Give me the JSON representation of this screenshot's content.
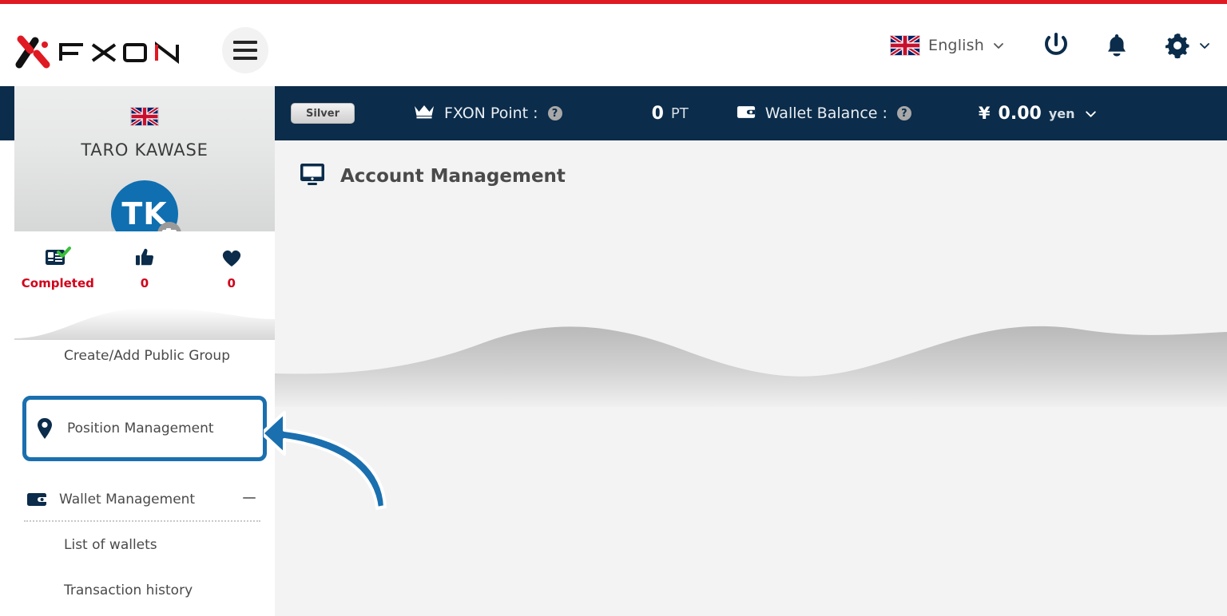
{
  "theme": {
    "accent_red": "#e01a22",
    "navy": "#0b2c4a",
    "highlight_blue": "#1a6faf",
    "avatar_blue": "#0f6fb0",
    "stat_red": "#d0021b",
    "content_bg": "#f3f3f3"
  },
  "header": {
    "logo_alt": "FXON",
    "menu_button": "menu-icon",
    "language": {
      "label": "English",
      "flag": "uk-flag",
      "chevron": "chevron-down-icon"
    },
    "power_icon": "power-icon",
    "bell_icon": "notification-bell-icon",
    "gear_icon": "gear-icon",
    "gear_chevron": "chevron-down-icon"
  },
  "sidebar": {
    "flag": "uk-flag",
    "user_name": "TARO KAWASE",
    "avatar_initials": "TK",
    "avatar_camera_icon": "camera-icon",
    "stats": [
      {
        "icon": "id-card-verified-icon",
        "label": "Completed"
      },
      {
        "icon": "thumbs-up-icon",
        "label": "0"
      },
      {
        "icon": "heart-icon",
        "label": "0"
      }
    ],
    "items": [
      {
        "label": "Create/Add Public Group",
        "icon": "",
        "type": "plain"
      },
      {
        "label": "Position Management",
        "icon": "location-pin-icon",
        "type": "highlighted"
      },
      {
        "label": "Wallet Management",
        "icon": "wallet-icon",
        "type": "expandable",
        "toggle": "minus-icon"
      },
      {
        "label": "List of wallets",
        "icon": "",
        "type": "sub"
      },
      {
        "label": "Transaction history",
        "icon": "",
        "type": "sub"
      }
    ]
  },
  "statusbar": {
    "tier_badge": "Silver",
    "fxon_point": {
      "icon": "crown-icon",
      "label": "FXON Point :",
      "help": "?",
      "value": "0",
      "unit": "PT"
    },
    "wallet_balance": {
      "icon": "wallet-icon",
      "label": "Wallet Balance :",
      "help": "?",
      "currency_symbol": "¥",
      "value": "0.00",
      "unit": "yen",
      "chevron": "chevron-down-icon"
    }
  },
  "main": {
    "page_icon": "monitor-icon",
    "page_title": "Account Management"
  },
  "annotation": {
    "arrow": "curved-arrow-pointing-left",
    "target": "Position Management"
  }
}
